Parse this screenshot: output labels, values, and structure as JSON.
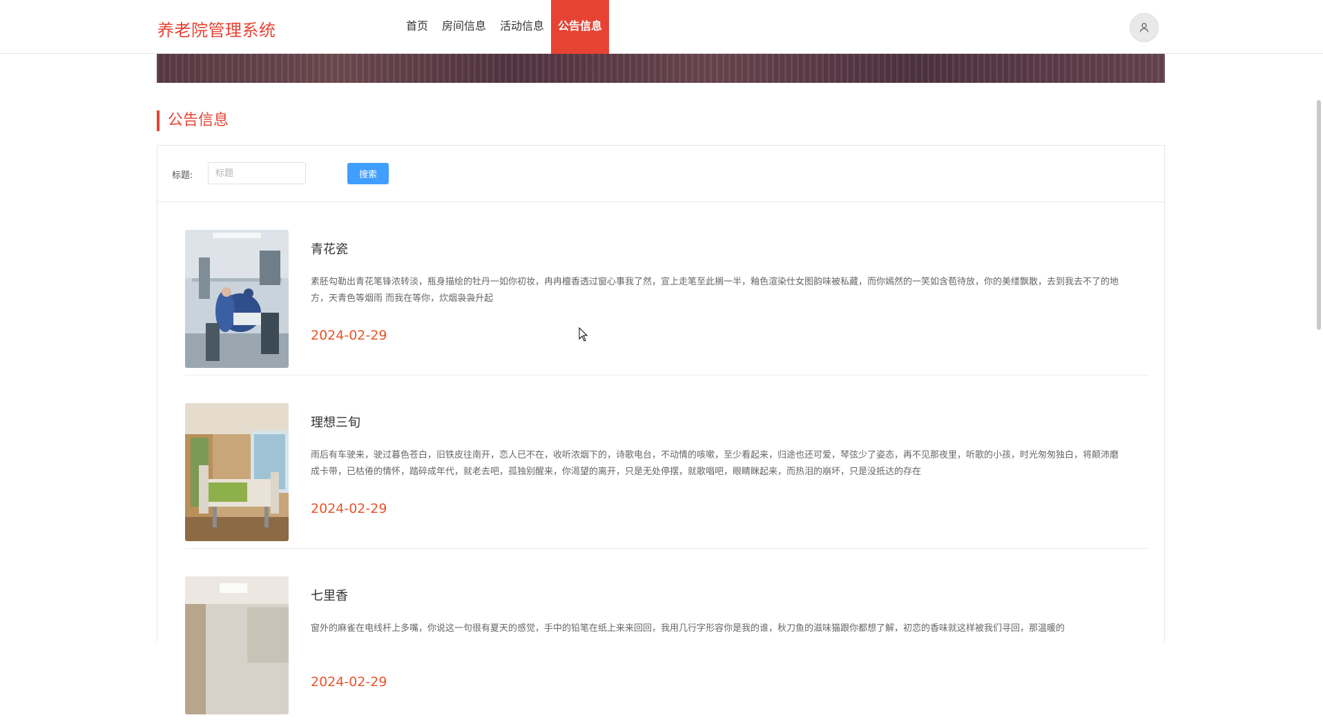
{
  "app": {
    "title": "养老院管理系统"
  },
  "nav": {
    "items": [
      {
        "label": "首页"
      },
      {
        "label": "房间信息"
      },
      {
        "label": "活动信息"
      },
      {
        "label": "公告信息",
        "active": true
      }
    ]
  },
  "section": {
    "title": "公告信息"
  },
  "search": {
    "label": "标题:",
    "placeholder": "标题",
    "value": "",
    "button_label": "搜索"
  },
  "news": [
    {
      "title": "青花瓷",
      "summary": "素胚勾勒出青花笔锋浓转淡，瓶身描绘的牡丹一如你初妆，冉冉檀香透过窗心事我了然，宣上走笔至此搁一半，釉色渲染仕女图韵味被私藏，而你嫣然的一笑如含苞待放，你的美缕飘散，去到我去不了的地方，天青色等烟雨 而我在等你，炊烟袅袅升起",
      "date": "2024-02-29"
    },
    {
      "title": "理想三旬",
      "summary": "雨后有车驶来，驶过暮色苍白，旧铁皮往南开，恋人已不在，收听浓烟下的，诗歌电台，不动情的咳嗽，至少看起来，归途也还可爱，琴弦少了姿态，再不见那夜里，听歌的小孩，时光匆匆独白，将颠沛磨成卡带，已枯倦的情怀，踏碎成年代，就老去吧，孤独别醒来，你渴望的离开，只是无处停摆，就歌唱吧，眼睛眯起来，而热泪的崩坏，只是没抵达的存在",
      "date": "2024-02-29"
    },
    {
      "title": "七里香",
      "summary": "窗外的麻雀在电线杆上多嘴，你说这一句很有夏天的感觉，手中的铅笔在纸上来来回回，我用几行字形容你是我的谁，秋刀鱼的滋味猫跟你都想了解，初恋的香味就这样被我们寻回，那温暖的",
      "date": "2024-02-29"
    }
  ],
  "icons": {
    "avatar": "user-icon",
    "cursor": "mouse-pointer-icon"
  },
  "colors": {
    "brand": "#e64334",
    "date": "#e6542a",
    "button": "#409eff"
  }
}
